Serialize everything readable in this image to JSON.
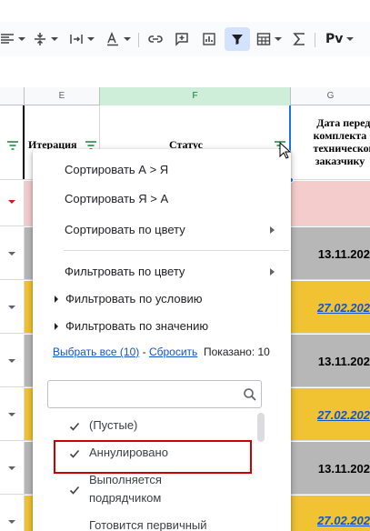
{
  "toolbar": {
    "icons": [
      "align-left-icon",
      "vertical-align-icon",
      "text-wrap-icon",
      "text-rotation-icon",
      "link-icon",
      "insert-comment-icon",
      "insert-chart-icon",
      "filter-icon",
      "table-views-icon",
      "functions-icon"
    ],
    "script_label": "Pv",
    "active_color": "#d3e3fd"
  },
  "columns": {
    "e": "E",
    "f": "F",
    "g": "G",
    "selected_color": "#cfeed9"
  },
  "header_row": {
    "iteration": "Итерация",
    "status": "Статус",
    "date_lines": [
      "Дата передач",
      "комплекта",
      "техническом",
      "заказчику"
    ]
  },
  "rows": [
    {
      "fill": "#f4cccc",
      "date": "",
      "link": false
    },
    {
      "fill": "#b7b7b7",
      "date": "13.11.202",
      "link": false
    },
    {
      "fill": "#f1c232",
      "date": "27.02.202",
      "link": true
    },
    {
      "fill": "#b7b7b7",
      "date": "13.11.202",
      "link": false
    },
    {
      "fill": "#f1c232",
      "date": "27.02.202",
      "link": true
    },
    {
      "fill": "#b7b7b7",
      "date": "13.11.202",
      "link": false
    },
    {
      "fill": "#f1c232",
      "date": "27.02.202",
      "link": true
    }
  ],
  "menu": {
    "sort_az": "Сортировать А > Я",
    "sort_za": "Сортировать Я > А",
    "sort_color": "Сортировать по цвету",
    "filter_color": "Фильтровать по цвету",
    "filter_condition": "Фильтровать по условию",
    "filter_values": "Фильтровать по значению",
    "select_all": "Выбрать все (10)",
    "dash": " - ",
    "reset": "Сбросить",
    "shown": "Показано: 10",
    "search_value": "",
    "values": [
      {
        "label": "(Пустые)",
        "checked": true
      },
      {
        "label": "Аннулировано",
        "checked": true
      },
      {
        "label": "Выполняется подрядчиком",
        "checked": true
      },
      {
        "label": "Готовится первичный",
        "checked": false
      }
    ]
  },
  "colors": {
    "highlight_border": "#cc0000",
    "link": "#1155cc",
    "filter_green": "#188038"
  }
}
